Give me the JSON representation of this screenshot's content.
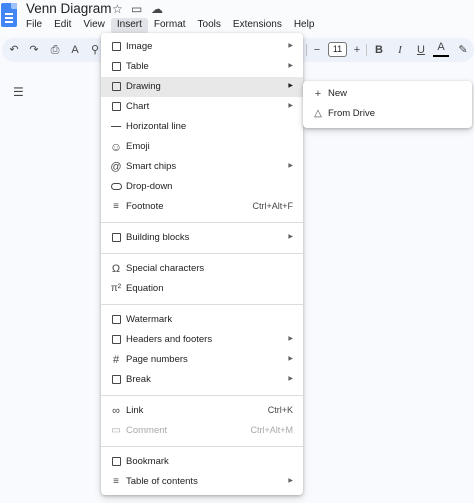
{
  "document": {
    "title": "Venn Diagram"
  },
  "menubar": [
    "File",
    "Edit",
    "View",
    "Insert",
    "Format",
    "Tools",
    "Extensions",
    "Help"
  ],
  "toolbar": {
    "font_size": "11"
  },
  "insert_menu": {
    "items": {
      "image": {
        "label": "Image"
      },
      "table": {
        "label": "Table"
      },
      "drawing": {
        "label": "Drawing"
      },
      "chart": {
        "label": "Chart"
      },
      "horizontal_line": {
        "label": "Horizontal line"
      },
      "emoji": {
        "label": "Emoji"
      },
      "smart_chips": {
        "label": "Smart chips"
      },
      "dropdown": {
        "label": "Drop-down"
      },
      "footnote": {
        "label": "Footnote",
        "shortcut": "Ctrl+Alt+F"
      },
      "building_blocks": {
        "label": "Building blocks"
      },
      "special_characters": {
        "label": "Special characters"
      },
      "equation": {
        "label": "Equation"
      },
      "watermark": {
        "label": "Watermark"
      },
      "headers_footers": {
        "label": "Headers and footers"
      },
      "page_numbers": {
        "label": "Page numbers"
      },
      "break": {
        "label": "Break"
      },
      "link": {
        "label": "Link",
        "shortcut": "Ctrl+K"
      },
      "comment": {
        "label": "Comment",
        "shortcut": "Ctrl+Alt+M"
      },
      "bookmark": {
        "label": "Bookmark"
      },
      "table_of_contents": {
        "label": "Table of contents"
      }
    }
  },
  "drawing_submenu": {
    "new": {
      "label": "New"
    },
    "from_drive": {
      "label": "From Drive"
    }
  }
}
